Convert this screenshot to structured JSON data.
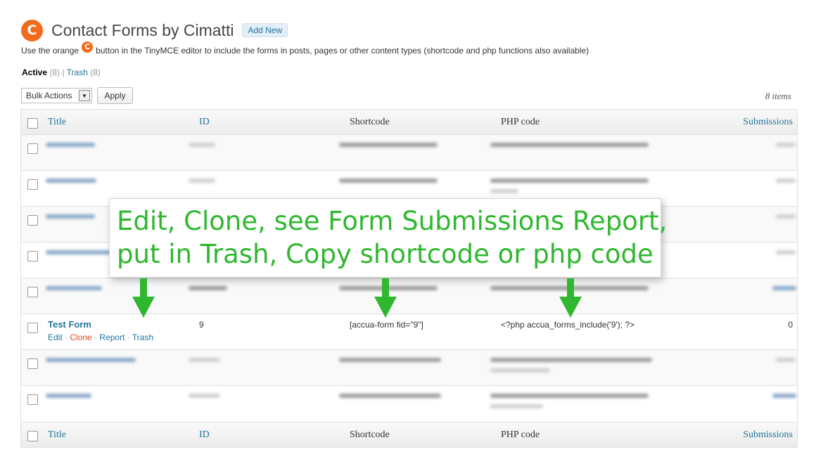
{
  "header": {
    "logo_letter": "C",
    "title": "Contact Forms by Cimatti",
    "add_new": "Add New"
  },
  "description": {
    "before": "Use the orange",
    "logo_letter": "C",
    "after": "button in the TinyMCE editor to include the forms in posts, pages or other content types (shortcode and php functions also available)"
  },
  "views": {
    "active_label": "Active",
    "active_count": "(8)",
    "separator": "|",
    "trash_label": "Trash",
    "trash_count": "(8)"
  },
  "toolbar": {
    "bulk_actions": "Bulk Actions",
    "apply": "Apply",
    "item_count": "8 items"
  },
  "columns": {
    "title": "Title",
    "id": "ID",
    "shortcode": "Shortcode",
    "php": "PHP code",
    "submissions": "Submissions"
  },
  "visible_row": {
    "title": "Test Form",
    "id": "9",
    "shortcode": "[accua-form fid=\"9\"]",
    "php": "<?php accua_forms_include('9'); ?>",
    "submissions": "0",
    "actions": {
      "edit": "Edit",
      "clone": "Clone",
      "report": "Report",
      "trash": "Trash",
      "sep": "·"
    }
  },
  "callout": {
    "line1": "Edit, Clone, see Form Submissions Report,",
    "line2": "put in Trash, Copy shortcode or php code",
    "color": "#2fb82f"
  },
  "colors": {
    "link": "#21759b",
    "brand_orange": "#f26a1b",
    "clone_red": "#d54e21"
  }
}
